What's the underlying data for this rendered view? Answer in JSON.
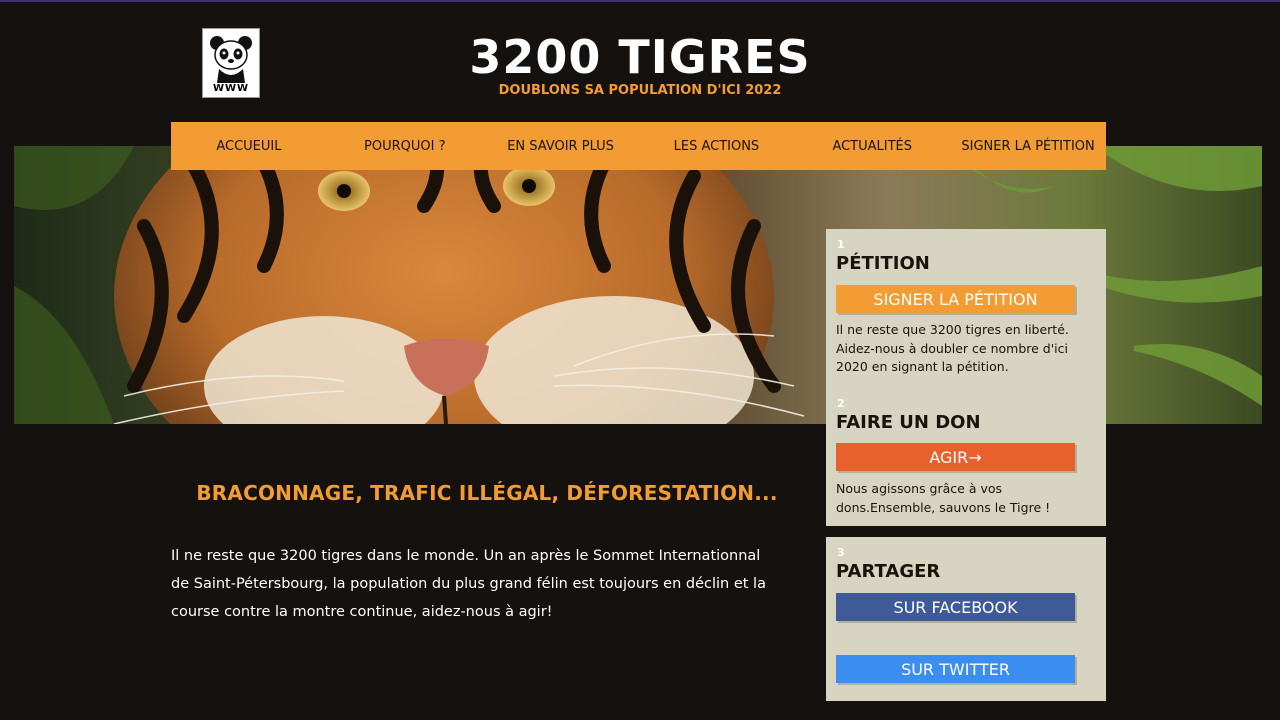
{
  "header": {
    "logo_text": "WWW",
    "title": "3200 TIGRES",
    "subtitle": "DOUBLONS SA POPULATION D'ICI 2022"
  },
  "nav": {
    "items": [
      {
        "label": "ACCUEUIL"
      },
      {
        "label": "POURQUOI ?"
      },
      {
        "label": "EN SAVOIR PLUS"
      },
      {
        "label": "LES ACTIONS"
      },
      {
        "label": "ACTUALITÉS"
      },
      {
        "label": "SIGNER LA PÉTITION"
      }
    ]
  },
  "main": {
    "headline": "BRACONNAGE, TRAFIC ILLÉGAL, DÉFORESTATION...",
    "intro": "Il ne reste que 3200 tigres dans le monde. Un an après le Sommet Internationnal de Saint-Pétersbourg, la population du plus grand félin est toujours en déclin et la course contre la montre continue, aidez-nous à agir!"
  },
  "sidebar": {
    "petition": {
      "number": "1",
      "title": "PÉTITION",
      "button": "SIGNER LA PÉTITION",
      "text": "Il ne reste que 3200 tigres en liberté. Aidez-nous à doubler ce nombre d'ici 2020 en signant la pétition."
    },
    "donate": {
      "number": "2",
      "title": "FAIRE UN DON",
      "button": "AGIR→",
      "text": "Nous agissons grâce à vos dons.Ensemble, sauvons le Tigre !"
    },
    "share": {
      "number": "3",
      "title": "PARTAGER",
      "facebook": "SUR FACEBOOK",
      "twitter": "SUR TWITTER"
    }
  },
  "colors": {
    "accent": "#f29c33",
    "background": "#15110e",
    "panel": "#d8d4c2",
    "donate": "#e8612c",
    "facebook": "#3e5a99",
    "twitter": "#3b8ef0"
  }
}
